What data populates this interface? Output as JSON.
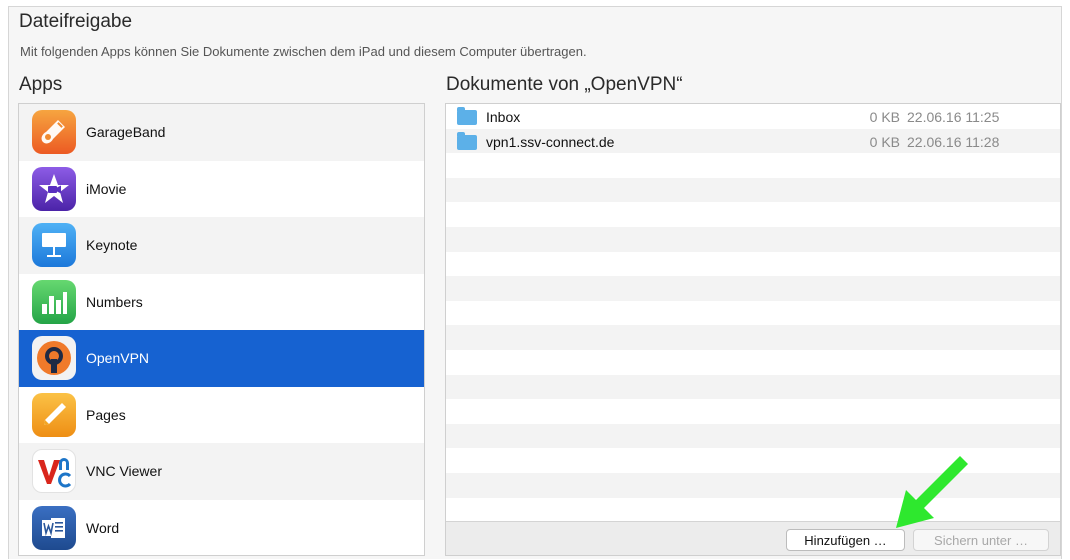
{
  "section": {
    "title": "Dateifreigabe",
    "description": "Mit folgenden Apps können Sie Dokumente zwischen dem iPad und diesem Computer übertragen."
  },
  "apps": {
    "heading": "Apps",
    "items": [
      {
        "label": "GarageBand",
        "icon": "garageband-icon",
        "color": "#f27c2a",
        "selected": false
      },
      {
        "label": "iMovie",
        "icon": "imovie-icon",
        "color": "#6a3fd0",
        "selected": false
      },
      {
        "label": "Keynote",
        "icon": "keynote-icon",
        "color": "#2f8ee6",
        "selected": false
      },
      {
        "label": "Numbers",
        "icon": "numbers-icon",
        "color": "#3cc05a",
        "selected": false
      },
      {
        "label": "OpenVPN",
        "icon": "openvpn-icon",
        "color": "#e8772e",
        "selected": true
      },
      {
        "label": "Pages",
        "icon": "pages-icon",
        "color": "#f3a623",
        "selected": false
      },
      {
        "label": "VNC Viewer",
        "icon": "vnc-viewer-icon",
        "color": "#d9261c",
        "selected": false
      },
      {
        "label": "Word",
        "icon": "word-icon",
        "color": "#2b579a",
        "selected": false
      }
    ]
  },
  "documents": {
    "heading": "Dokumente von „OpenVPN“",
    "items": [
      {
        "name": "Inbox",
        "size": "0 KB",
        "date": "22.06.16 11:25"
      },
      {
        "name": "vpn1.ssv-connect.de",
        "size": "0 KB",
        "date": "22.06.16 11:28"
      }
    ],
    "add_button": "Hinzufügen …",
    "save_button": "Sichern unter …"
  },
  "colors": {
    "selection": "#1662d1",
    "annotation_arrow": "#2ee82e",
    "folder": "#5cb0e8"
  }
}
